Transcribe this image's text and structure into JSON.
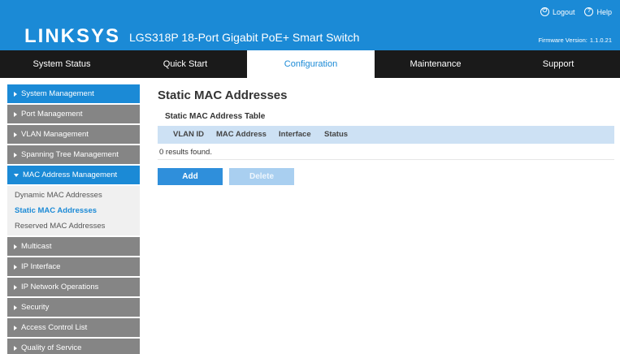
{
  "header": {
    "brand": "LINKSYS",
    "product": "LGS318P 18-Port Gigabit PoE+ Smart Switch",
    "logout_label": "Logout",
    "help_label": "Help",
    "firmware_label": "Firmware Version:",
    "firmware_value": "1.1.0.21"
  },
  "nav": {
    "tabs": [
      {
        "label": "System Status"
      },
      {
        "label": "Quick Start"
      },
      {
        "label": "Configuration"
      },
      {
        "label": "Maintenance"
      },
      {
        "label": "Support"
      }
    ],
    "active": "Configuration"
  },
  "sidebar": {
    "items_top": [
      {
        "label": "System Management"
      },
      {
        "label": "Port Management"
      },
      {
        "label": "VLAN Management"
      },
      {
        "label": "Spanning Tree Management"
      },
      {
        "label": "MAC Address Management"
      }
    ],
    "subitems": [
      {
        "label": "Dynamic MAC Addresses"
      },
      {
        "label": "Static MAC Addresses"
      },
      {
        "label": "Reserved MAC Addresses"
      }
    ],
    "items_bottom": [
      {
        "label": "Multicast"
      },
      {
        "label": "IP Interface"
      },
      {
        "label": "IP Network Operations"
      },
      {
        "label": "Security"
      },
      {
        "label": "Access Control List"
      },
      {
        "label": "Quality of Service"
      }
    ]
  },
  "main": {
    "title": "Static MAC Addresses",
    "table_title": "Static MAC Address Table",
    "columns": [
      "VLAN ID",
      "MAC Address",
      "Interface",
      "Status"
    ],
    "results_text": "0 results found.",
    "add_label": "Add",
    "delete_label": "Delete"
  },
  "colors": {
    "accent": "#1b8ad6",
    "nav_bg": "#1a1a1a",
    "sidebar_bg": "#858585",
    "table_header": "#cde1f4"
  }
}
